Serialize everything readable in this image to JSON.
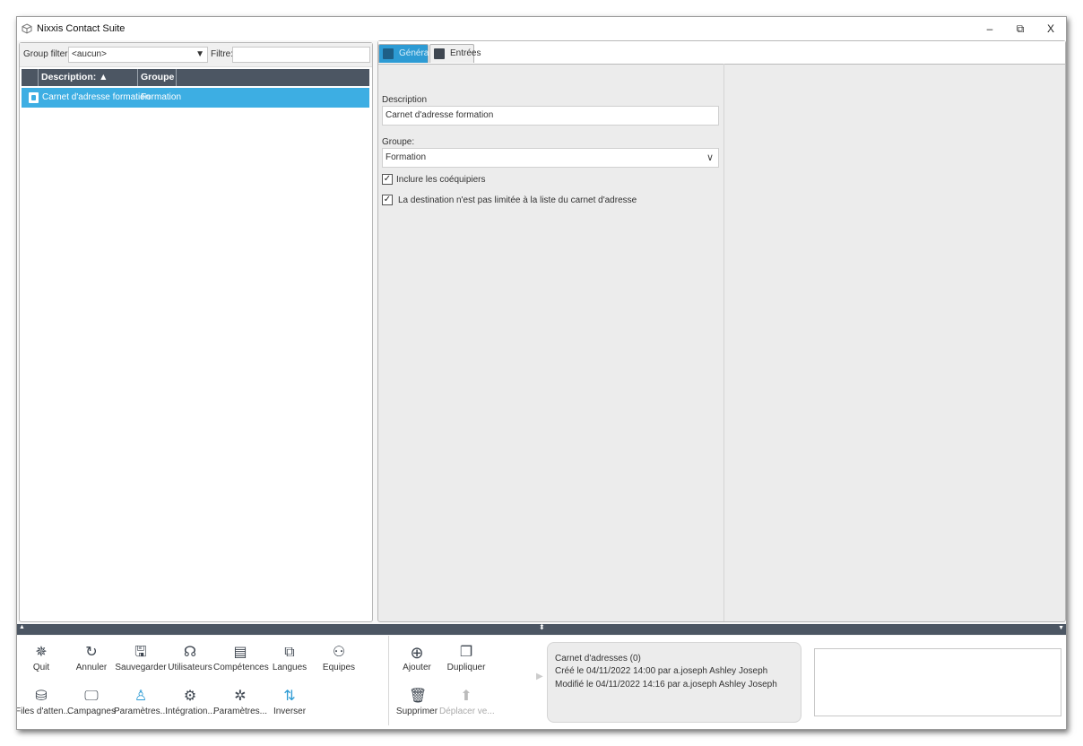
{
  "window": {
    "title": "Nixxis Contact Suite",
    "controls": {
      "minimize": "–",
      "restore": "⧉",
      "close": "X"
    }
  },
  "left": {
    "group_filter_label": "Group filter:",
    "group_filter_value": "<aucun>",
    "filter_label": "Filtre:",
    "filter_value": "",
    "columns": [
      "Description: ▲",
      "Groupe"
    ],
    "rows": [
      {
        "description": "Carnet d'adresse formation",
        "groupe": "Formation",
        "selected": true
      }
    ]
  },
  "tabs": [
    {
      "label": "Général",
      "active": true
    },
    {
      "label": "Entrées",
      "active": false
    }
  ],
  "form": {
    "description_label": "Description",
    "description_value": "Carnet d'adresse formation",
    "groupe_label": "Groupe:",
    "groupe_value": "Formation",
    "check1": {
      "label": "Inclure les coéquipiers",
      "checked": true
    },
    "check2": {
      "label": "La destination n'est pas limitée à la liste du carnet d'adresse",
      "checked": true
    }
  },
  "toolbar": {
    "row1": [
      "Quit",
      "Annuler",
      "Sauvegarder",
      "Utilisateurs",
      "Compétences",
      "Langues",
      "Equipes"
    ],
    "row2": [
      "Files d'atten...",
      "Campagnes",
      "Paramètres...",
      "Intégration...",
      "Paramètres...",
      "Inverser"
    ],
    "actions": {
      "add": "Ajouter",
      "duplicate": "Dupliquer",
      "delete": "Supprimer",
      "move": "Déplacer ve..."
    }
  },
  "info": {
    "line1": "Carnet d'adresses (0)",
    "line2": "Créé le 04/11/2022 14:00 par a.joseph Ashley Joseph",
    "line3": "Modifié le 04/11/2022 14:16 par a.joseph Ashley Joseph"
  },
  "colors": {
    "accent": "#3daee3",
    "header": "#4c5663"
  },
  "icons": {
    "quit": "crosshair-icon",
    "annuler": "refresh-icon",
    "sauvegarder": "save-icon",
    "utilisateurs": "headset-icon",
    "competences": "document-icon",
    "langues": "language-icon",
    "equipes": "team-icon",
    "files": "database-icon",
    "campagnes": "monitor-icon",
    "parametres1": "user-gear-icon",
    "integration": "integration-gear-icon",
    "parametres2": "gear-icon",
    "inverser": "swap-icon",
    "ajouter": "plus-circle-icon",
    "dupliquer": "copy-icon",
    "supprimer": "trash-icon",
    "deplacer": "arrow-up-icon"
  }
}
